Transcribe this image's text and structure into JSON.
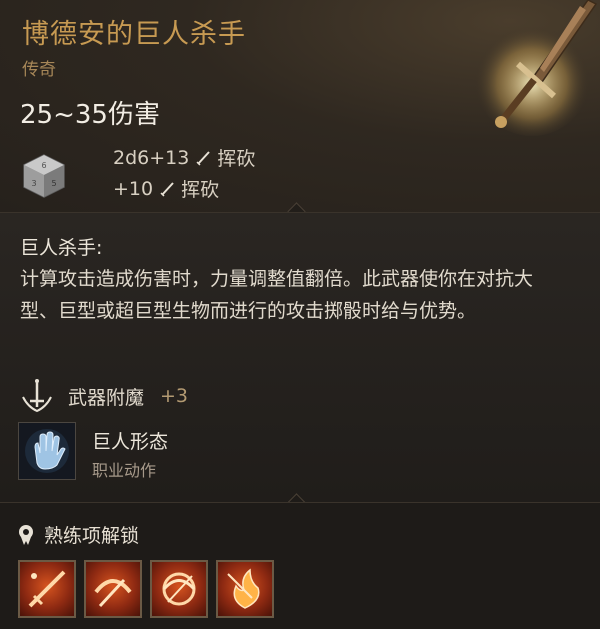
{
  "item": {
    "name": "博德安的巨人杀手",
    "rarity": "传奇",
    "damage_range": "25~35伤害",
    "damage_lines": [
      {
        "dice": "2d6+13",
        "type": "挥砍"
      },
      {
        "dice": "+10",
        "type": "挥砍"
      }
    ]
  },
  "ability": {
    "title": "巨人杀手:",
    "description": "计算攻击造成伤害时，力量调整值翻倍。此武器使你在对抗大型、巨型或超巨型生物而进行的攻击掷骰时给与优势。"
  },
  "enchantment": {
    "label": "武器附魔",
    "value": "+3"
  },
  "action": {
    "name": "巨人形态",
    "type": "职业动作"
  },
  "proficiency": {
    "label": "熟练项解锁",
    "skills": [
      {
        "icon": "slash-skill-icon"
      },
      {
        "icon": "cleave-skill-icon"
      },
      {
        "icon": "whirl-skill-icon"
      },
      {
        "icon": "flame-skill-icon"
      }
    ]
  },
  "colors": {
    "name": "#c79a52",
    "rarity": "#a78758",
    "text": "#e1dacd",
    "skill_bg": "#d6541f"
  }
}
